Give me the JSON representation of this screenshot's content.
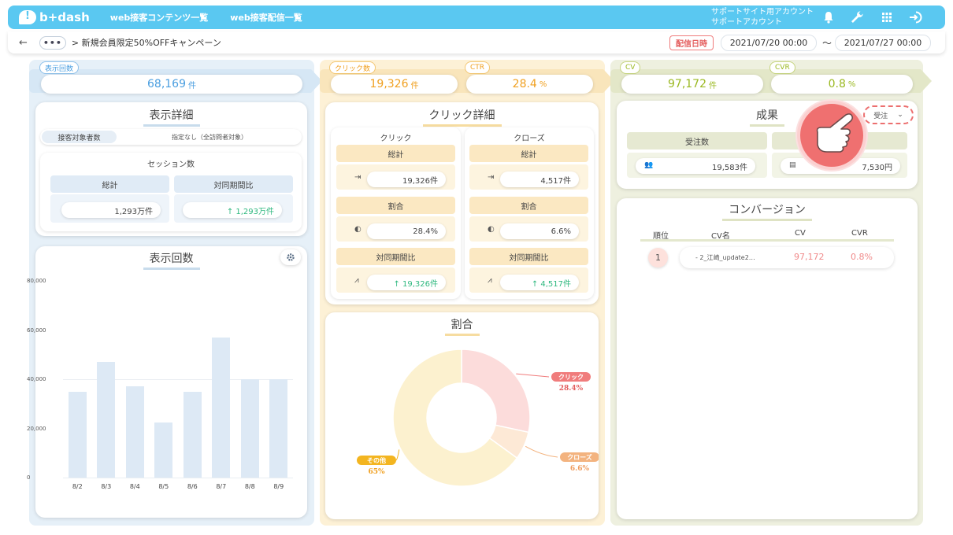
{
  "header": {
    "logo_text": "b+dash",
    "nav": [
      "web接客コンテンツ一覧",
      "web接客配信一覧"
    ],
    "account_line1": "サポートサイト用アカウント",
    "account_line2": "サポートアカウント",
    "icons": [
      "bell-icon",
      "wrench-icon",
      "grid-icon",
      "logout-icon"
    ]
  },
  "breadcrumb": {
    "back": "←",
    "dots": "•••",
    "text": "> 新規会員限定50%OFFキャンペーン",
    "date_label": "配信日時",
    "date_from": "2021/07/20 00:00",
    "tilde": "〜",
    "date_to": "2021/07/27 00:00"
  },
  "colors": {
    "blue_band": "#e6f0f8",
    "yellow_band": "#fdf1d6",
    "green_band": "#eef0df",
    "blue_text": "#4a9ee0",
    "orange_text": "#f0a020",
    "green_text": "#9ab820",
    "red": "#f08080",
    "teal": "#2eb87f"
  },
  "impressions": {
    "tag": "表示回数",
    "value": "68,169",
    "unit": "件",
    "detail": {
      "title": "表示詳細",
      "tab_active": "接客対象者数",
      "tab_value": "指定なし（全訪問者対象）",
      "session_title": "セッション数",
      "total_label": "総計",
      "compare_label": "対同期間比",
      "total_value": "1,293万件",
      "compare_value": "↑ 1,293万件"
    },
    "chart_title": "表示回数"
  },
  "clicks": {
    "click_tag": "クリック数",
    "click_value": "19,326",
    "click_unit": "件",
    "ctr_tag": "CTR",
    "ctr_value": "28.4",
    "ctr_unit": "%",
    "detail_title": "クリック詳細",
    "click_col": {
      "title": "クリック",
      "total_label": "総計",
      "total": "19,326件",
      "ratio_label": "割合",
      "ratio": "28.4%",
      "compare_label": "対同期間比",
      "compare": "↑ 19,326件"
    },
    "close_col": {
      "title": "クローズ",
      "total_label": "総計",
      "total": "4,517件",
      "ratio_label": "割合",
      "ratio": "6.6%",
      "compare_label": "対同期間比",
      "compare": "↑ 4,517件"
    },
    "ratio_title": "割合",
    "donut_labels": [
      {
        "name": "クリック",
        "pct": "28.4%"
      },
      {
        "name": "クローズ",
        "pct": "6.6%"
      },
      {
        "name": "その他",
        "pct": "65%"
      }
    ]
  },
  "conversions": {
    "cv_tag": "CV",
    "cv_value": "97,172",
    "cv_unit": "件",
    "cvr_tag": "CVR",
    "cvr_value": "0.8",
    "cvr_unit": "%",
    "result_title": "成果",
    "dropdown": "受注",
    "orders_label": "受注数",
    "orders_value": "19,583件",
    "amount_value": "7,530円",
    "conv_title": "コンバージョン",
    "table_headers": [
      "順位",
      "CV名",
      "CV",
      "CVR"
    ],
    "rows": [
      {
        "rank": "1",
        "name": "- 2_江崎_update2…",
        "cv": "97,172",
        "cvr": "0.8%"
      }
    ]
  },
  "chart_data": {
    "type": "bar",
    "title": "表示回数",
    "categories": [
      "8/2",
      "8/3",
      "8/4",
      "8/5",
      "8/6",
      "8/7",
      "8/8",
      "8/9"
    ],
    "values": [
      35000,
      47000,
      37000,
      22500,
      35000,
      57000,
      40000,
      40000
    ],
    "yticks": [
      "80,000",
      "60,000",
      "40,000",
      "20,000",
      "0"
    ],
    "ylim": [
      0,
      80000
    ],
    "grid": true
  },
  "donut_data": {
    "type": "pie",
    "labels": [
      "クリック",
      "クローズ",
      "その他"
    ],
    "values": [
      28.4,
      6.6,
      65
    ],
    "colors": [
      "#fcdcdb",
      "#fde9d6",
      "#fcf1cf"
    ]
  }
}
